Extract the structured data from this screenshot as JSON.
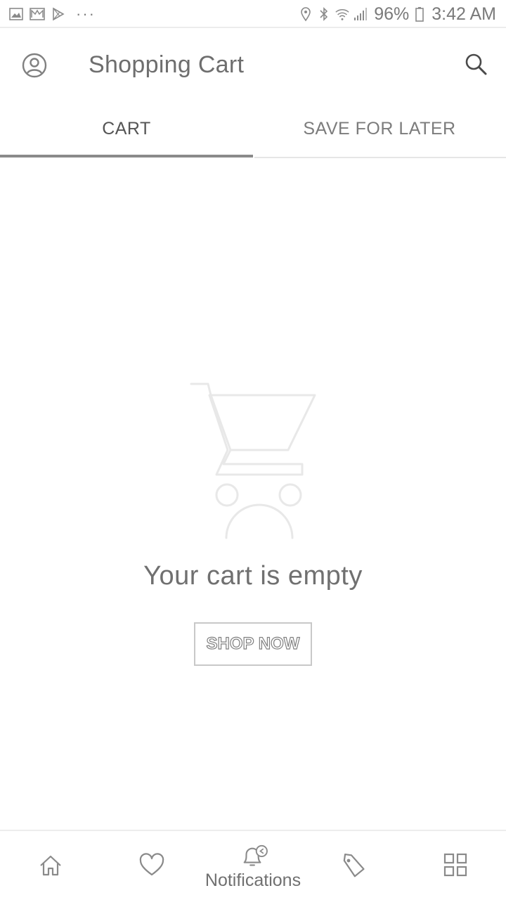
{
  "status_bar": {
    "battery": "96%",
    "time": "3:42 AM",
    "overflow": "···"
  },
  "app_bar": {
    "title": "Shopping Cart",
    "left_icon": "account-circle-icon",
    "right_icon": "search-icon"
  },
  "tabs": [
    {
      "label": "CART",
      "active": true
    },
    {
      "label": "SAVE FOR LATER",
      "active": false
    }
  ],
  "empty_state": {
    "icon": "sad-cart-icon",
    "message": "Your cart is empty",
    "button_label": "SHOP NOW"
  },
  "bottom_nav": {
    "items": [
      {
        "icon": "home-icon"
      },
      {
        "icon": "heart-icon"
      },
      {
        "icon": "bell-icon",
        "label": "Notifications"
      },
      {
        "icon": "tag-icon"
      },
      {
        "icon": "grid-icon"
      }
    ]
  },
  "colors": {
    "accent_indicator": "#8a8a8a",
    "text_primary": "#6e6e6e",
    "divider": "#e6e6e6"
  }
}
